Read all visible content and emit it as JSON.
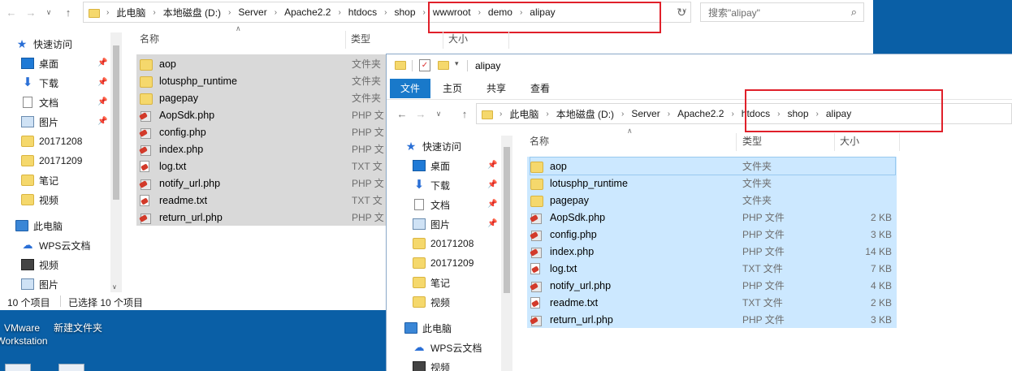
{
  "desktop": {
    "icons": [
      {
        "label_line1": "VMware",
        "label_line2": "Workstation"
      },
      {
        "label_line1": "新建文件夹"
      }
    ]
  },
  "back_window": {
    "address_crumbs": [
      "此电脑",
      "本地磁盘 (D:)",
      "Server",
      "Apache2.2",
      "htdocs",
      "shop",
      "wwwroot",
      "demo",
      "alipay"
    ],
    "search_placeholder": "搜索\"alipay\"",
    "columns": {
      "name": "名称",
      "type": "类型",
      "size": "大小"
    },
    "sidebar": [
      {
        "label": "快速访问",
        "icon": "star-icon"
      },
      {
        "label": "桌面",
        "icon": "desktop-icon",
        "pinned": true
      },
      {
        "label": "下载",
        "icon": "download-icon",
        "pinned": true
      },
      {
        "label": "文档",
        "icon": "document-icon",
        "pinned": true
      },
      {
        "label": "图片",
        "icon": "pictures-icon",
        "pinned": true
      },
      {
        "label": "20171208",
        "icon": "folder-icon"
      },
      {
        "label": "20171209",
        "icon": "folder-icon"
      },
      {
        "label": "笔记",
        "icon": "folder-icon"
      },
      {
        "label": "视频",
        "icon": "folder-icon"
      },
      {
        "label": "此电脑",
        "icon": "pc-icon"
      },
      {
        "label": "WPS云文档",
        "icon": "cloud-icon"
      },
      {
        "label": "视频",
        "icon": "video-icon"
      },
      {
        "label": "图片",
        "icon": "pictures-icon"
      }
    ],
    "files": [
      {
        "name": "aop",
        "type": "文件夹",
        "kind": "folder"
      },
      {
        "name": "lotusphp_runtime",
        "type": "文件夹",
        "kind": "folder"
      },
      {
        "name": "pagepay",
        "type": "文件夹",
        "kind": "folder"
      },
      {
        "name": "AopSdk.php",
        "type": "PHP 文",
        "kind": "php"
      },
      {
        "name": "config.php",
        "type": "PHP 文",
        "kind": "php"
      },
      {
        "name": "index.php",
        "type": "PHP 文",
        "kind": "php"
      },
      {
        "name": "log.txt",
        "type": "TXT 文",
        "kind": "txt"
      },
      {
        "name": "notify_url.php",
        "type": "PHP 文",
        "kind": "php"
      },
      {
        "name": "readme.txt",
        "type": "TXT 文",
        "kind": "txt"
      },
      {
        "name": "return_url.php",
        "type": "PHP 文",
        "kind": "php"
      }
    ],
    "status_count": "10 个项目",
    "status_selected": "已选择 10 个项目"
  },
  "front_window": {
    "title": "alipay",
    "ribbon_tabs": [
      "文件",
      "主页",
      "共享",
      "查看"
    ],
    "address_crumbs": [
      "此电脑",
      "本地磁盘 (D:)",
      "Server",
      "Apache2.2",
      "htdocs",
      "shop",
      "alipay"
    ],
    "columns": {
      "name": "名称",
      "type": "类型",
      "size": "大小"
    },
    "sidebar": [
      {
        "label": "快速访问",
        "icon": "star-icon"
      },
      {
        "label": "桌面",
        "icon": "desktop-icon",
        "pinned": true
      },
      {
        "label": "下载",
        "icon": "download-icon",
        "pinned": true
      },
      {
        "label": "文档",
        "icon": "document-icon",
        "pinned": true
      },
      {
        "label": "图片",
        "icon": "pictures-icon",
        "pinned": true
      },
      {
        "label": "20171208",
        "icon": "folder-icon"
      },
      {
        "label": "20171209",
        "icon": "folder-icon"
      },
      {
        "label": "笔记",
        "icon": "folder-icon"
      },
      {
        "label": "视频",
        "icon": "folder-icon"
      },
      {
        "label": "此电脑",
        "icon": "pc-icon"
      },
      {
        "label": "WPS云文档",
        "icon": "cloud-icon"
      },
      {
        "label": "视频",
        "icon": "video-icon"
      }
    ],
    "files": [
      {
        "name": "aop",
        "type": "文件夹",
        "size": "",
        "kind": "folder"
      },
      {
        "name": "lotusphp_runtime",
        "type": "文件夹",
        "size": "",
        "kind": "folder"
      },
      {
        "name": "pagepay",
        "type": "文件夹",
        "size": "",
        "kind": "folder"
      },
      {
        "name": "AopSdk.php",
        "type": "PHP 文件",
        "size": "2 KB",
        "kind": "php"
      },
      {
        "name": "config.php",
        "type": "PHP 文件",
        "size": "3 KB",
        "kind": "php"
      },
      {
        "name": "index.php",
        "type": "PHP 文件",
        "size": "14 KB",
        "kind": "php"
      },
      {
        "name": "log.txt",
        "type": "TXT 文件",
        "size": "7 KB",
        "kind": "txt"
      },
      {
        "name": "notify_url.php",
        "type": "PHP 文件",
        "size": "4 KB",
        "kind": "php"
      },
      {
        "name": "readme.txt",
        "type": "TXT 文件",
        "size": "2 KB",
        "kind": "txt"
      },
      {
        "name": "return_url.php",
        "type": "PHP 文件",
        "size": "3 KB",
        "kind": "php"
      }
    ]
  },
  "colors": {
    "desktop": "#0a5fa6",
    "selection_back": "#d9d9d9",
    "selection_front": "#cce8ff",
    "ribbon_active": "#1979ca",
    "annotation": "#e0202a"
  }
}
